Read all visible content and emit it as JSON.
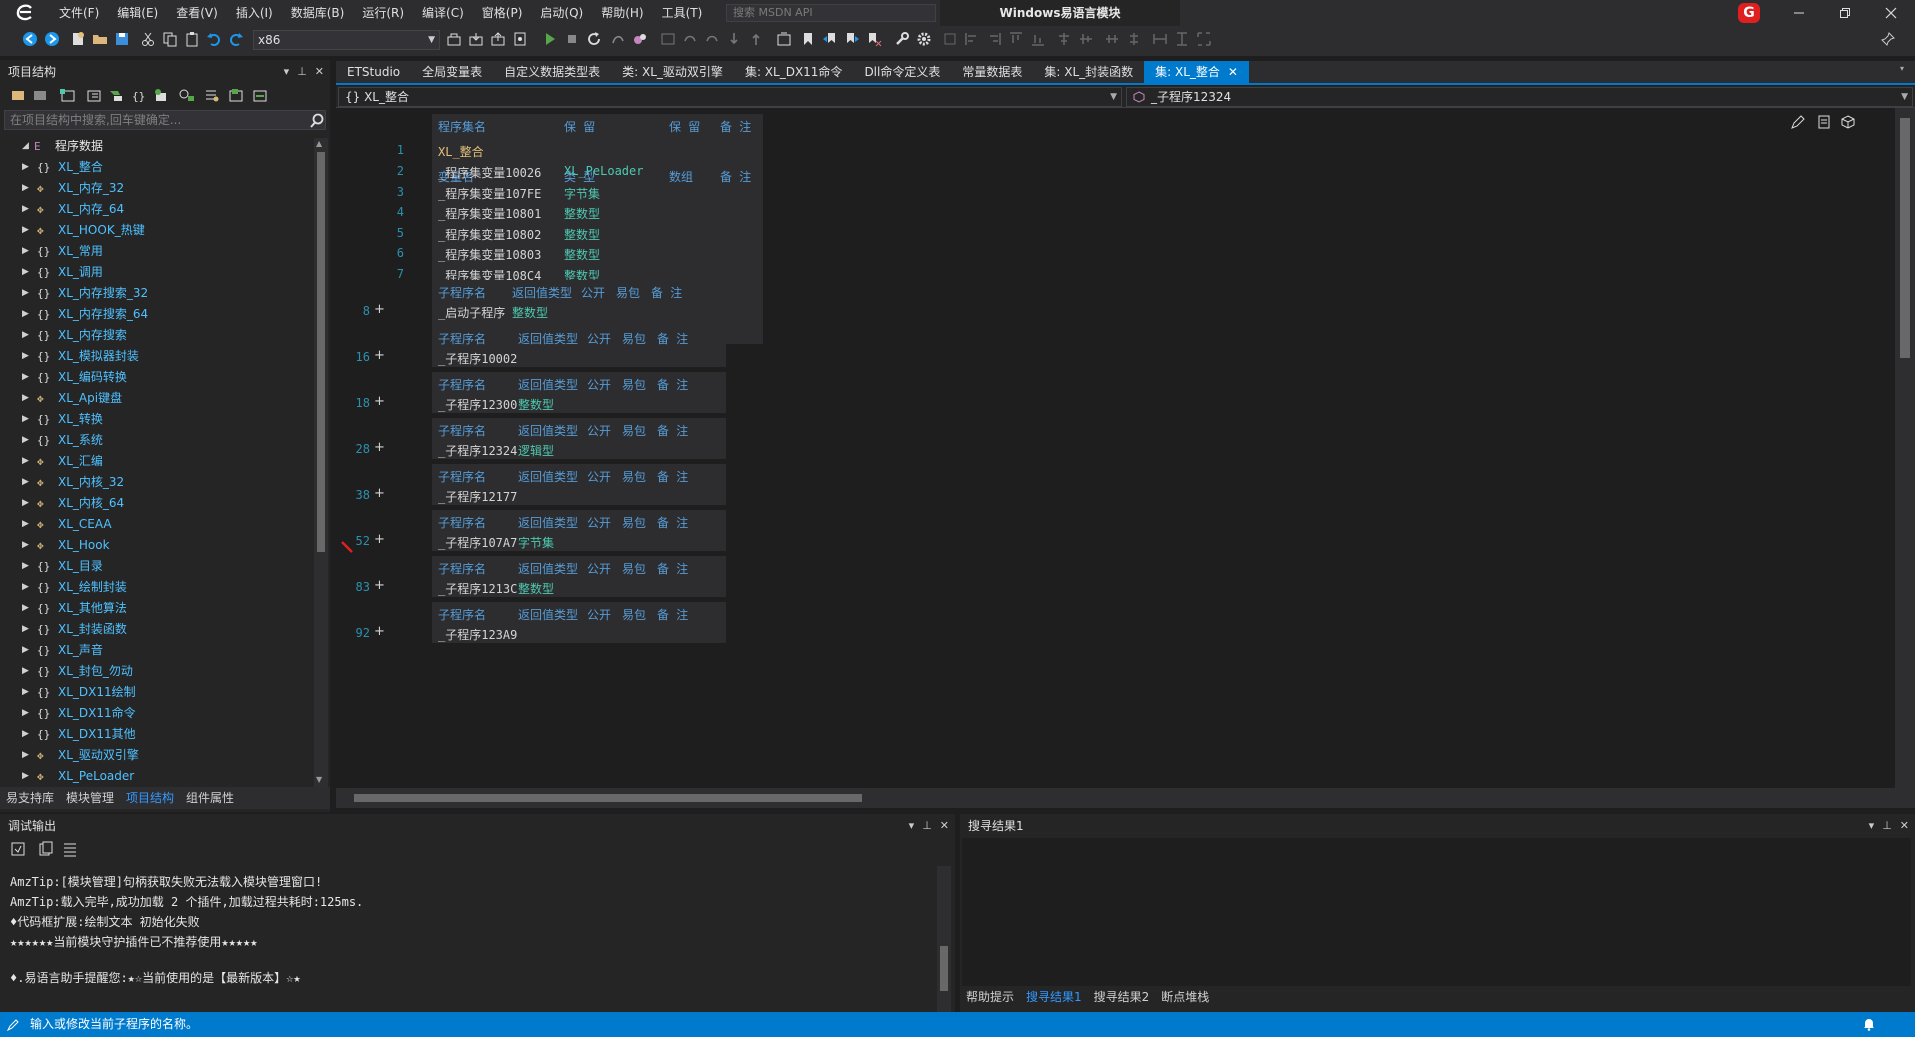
{
  "menu": [
    "文件(F)",
    "编辑(E)",
    "查看(V)",
    "插入(I)",
    "数据库(B)",
    "运行(R)",
    "编译(C)",
    "窗格(P)",
    "启动(Q)",
    "帮助(H)",
    "工具(T)"
  ],
  "search_placeholder": "搜索 MSDN API",
  "window_title": "Windows易语言模块",
  "badge": "G",
  "toolbar": {
    "platform": "x86"
  },
  "left_panel": {
    "title": "项目结构",
    "search_placeholder": "在项目结构中搜索,回车键确定...",
    "tree": {
      "root": "程序数据",
      "items": [
        {
          "label": "XL_整合",
          "icon": "{}"
        },
        {
          "label": "XL_内存_32",
          "icon": "class"
        },
        {
          "label": "XL_内存_64",
          "icon": "class"
        },
        {
          "label": "XL_HOOK_热键",
          "icon": "class"
        },
        {
          "label": "XL_常用",
          "icon": "{}"
        },
        {
          "label": "XL_调用",
          "icon": "{}"
        },
        {
          "label": "XL_内存搜索_32",
          "icon": "{}"
        },
        {
          "label": "XL_内存搜索_64",
          "icon": "{}"
        },
        {
          "label": "XL_内存搜索",
          "icon": "{}"
        },
        {
          "label": "XL_模拟器封装",
          "icon": "{}"
        },
        {
          "label": "XL_编码转换",
          "icon": "{}"
        },
        {
          "label": "XL_Api键盘",
          "icon": "class"
        },
        {
          "label": "XL_转换",
          "icon": "{}"
        },
        {
          "label": "XL_系统",
          "icon": "{}"
        },
        {
          "label": "XL_汇编",
          "icon": "class"
        },
        {
          "label": "XL_内核_32",
          "icon": "class"
        },
        {
          "label": "XL_内核_64",
          "icon": "class"
        },
        {
          "label": "XL_CEAA",
          "icon": "class"
        },
        {
          "label": "XL_Hook",
          "icon": "class"
        },
        {
          "label": "XL_目录",
          "icon": "{}"
        },
        {
          "label": "XL_绘制封装",
          "icon": "{}"
        },
        {
          "label": "XL_其他算法",
          "icon": "{}"
        },
        {
          "label": "XL_封装函数",
          "icon": "{}"
        },
        {
          "label": "XL_声音",
          "icon": "{}"
        },
        {
          "label": "XL_封包_勿动",
          "icon": "{}"
        },
        {
          "label": "XL_DX11绘制",
          "icon": "{}"
        },
        {
          "label": "XL_DX11命令",
          "icon": "{}"
        },
        {
          "label": "XL_DX11其他",
          "icon": "{}"
        },
        {
          "label": "XL_驱动双引擎",
          "icon": "class"
        },
        {
          "label": "XL_PeLoader",
          "icon": "class"
        }
      ]
    },
    "tabs": [
      "易支持库",
      "模块管理",
      "项目结构",
      "组件属性"
    ],
    "active_tab": "项目结构"
  },
  "editor_tabs": [
    "ETStudio",
    "全局变量表",
    "自定义数据类型表",
    "类: XL_驱动双引擎",
    "集: XL_DX11命令",
    "Dll命令定义表",
    "常量数据表",
    "集: XL_封装函数",
    "集: XL_整合"
  ],
  "active_editor_tab": "集: XL_整合",
  "nav": {
    "left": "{} XL_整合",
    "right": "_子程序12324"
  },
  "assembly": {
    "headers": [
      "程序集名",
      "保 留",
      "保 留",
      "备 注"
    ],
    "line": "1",
    "name": "XL_整合",
    "var_headers": [
      "变量名",
      "类 型",
      "数组",
      "备 注"
    ],
    "vars": [
      {
        "line": "2",
        "name": "_程序集变量10026",
        "type": "XL_PeLoader"
      },
      {
        "line": "3",
        "name": "_程序集变量107FE",
        "type": "字节集"
      },
      {
        "line": "4",
        "name": "_程序集变量10801",
        "type": "整数型"
      },
      {
        "line": "5",
        "name": "_程序集变量10802",
        "type": "整数型"
      },
      {
        "line": "6",
        "name": "_程序集变量10803",
        "type": "整数型"
      },
      {
        "line": "7",
        "name": "_程序集变量108C4",
        "type": "整数型"
      }
    ]
  },
  "sub_headers": [
    "子程序名",
    "返回值类型",
    "公开",
    "易包",
    "备 注"
  ],
  "subs": [
    {
      "line": "8",
      "name": "_启动子程序",
      "ret": "整数型"
    },
    {
      "line": "16",
      "name": "_子程序10002",
      "ret": ""
    },
    {
      "line": "18",
      "name": "_子程序12300",
      "ret": "整数型"
    },
    {
      "line": "28",
      "name": "_子程序12324",
      "ret": "逻辑型"
    },
    {
      "line": "38",
      "name": "_子程序12177",
      "ret": ""
    },
    {
      "line": "52",
      "name": "_子程序107A7",
      "ret": "字节集"
    },
    {
      "line": "83",
      "name": "_子程序1213C",
      "ret": "整数型"
    },
    {
      "line": "92",
      "name": "_子程序123A9",
      "ret": ""
    }
  ],
  "debug": {
    "title": "调试输出",
    "lines": [
      "AmzTip:[模块管理]句柄获取失败无法载入模块管理窗口!",
      "AmzTip:载入完毕,成功加载 2 个插件,加载过程共耗时:125ms.",
      "♦代码框扩展:绘制文本 初始化失败",
      "★★★★★★当前模块守护插件已不推荐使用★★★★★",
      "",
      "♦.易语言助手提醒您:★☆当前使用的是【最新版本】☆★"
    ]
  },
  "search_results": {
    "title": "搜寻结果1",
    "tabs": [
      "帮助提示",
      "搜寻结果1",
      "搜寻结果2",
      "断点堆栈"
    ],
    "active_tab": "搜寻结果1"
  },
  "status": "输入或修改当前子程序的名称。",
  "colors": {
    "accent": "#007acc",
    "background": "#1e1e1e",
    "panel": "#252526",
    "keyword": "#569cd6",
    "type": "#4ec9b0",
    "badge": "#e02020"
  }
}
